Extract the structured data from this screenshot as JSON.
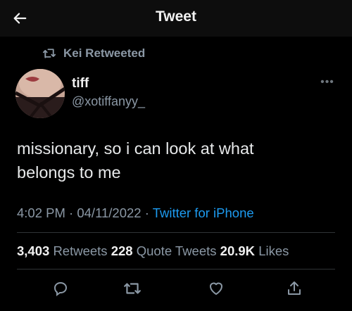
{
  "header": {
    "title": "Tweet"
  },
  "retweet_context": {
    "label": "Kei Retweeted"
  },
  "author": {
    "name": "tiff",
    "handle": "@xotiffanyy_"
  },
  "tweet": {
    "text_line1": "missionary, so i can look at what",
    "text_line2": "belongs to me",
    "time": "4:02 PM",
    "date": "04/11/2022",
    "source": "Twitter for iPhone"
  },
  "stats": {
    "retweets_count": "3,403",
    "retweets_label": "Retweets",
    "quotes_count": "228",
    "quotes_label": "Quote Tweets",
    "likes_count": "20.9K",
    "likes_label": "Likes"
  },
  "colors": {
    "background": "#000000",
    "link": "#1d9bf0",
    "muted": "#8b98a5"
  },
  "icons": [
    "back-arrow-icon",
    "retweet-icon",
    "more-icon",
    "reply-icon",
    "like-icon",
    "share-icon"
  ]
}
